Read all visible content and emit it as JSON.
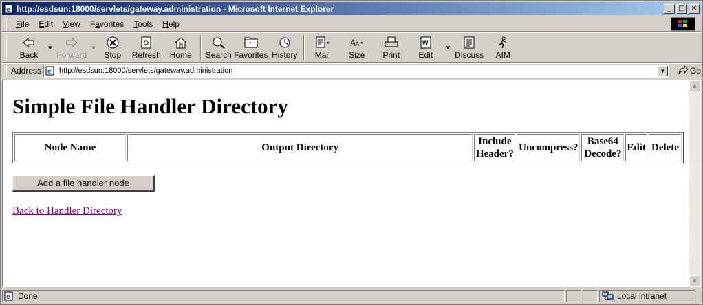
{
  "window": {
    "title": "http://esdsun:18000/servlets/gateway.administration - Microsoft Internet Explorer",
    "controls": {
      "minimize": "_",
      "maximize": "□",
      "close": "✕"
    }
  },
  "menu": {
    "items": [
      {
        "label": "File",
        "key": "F"
      },
      {
        "label": "Edit",
        "key": "E"
      },
      {
        "label": "View",
        "key": "V"
      },
      {
        "label": "Favorites",
        "key": "a"
      },
      {
        "label": "Tools",
        "key": "T"
      },
      {
        "label": "Help",
        "key": "H"
      }
    ]
  },
  "toolbar": {
    "back": "Back",
    "forward": "Forward",
    "stop": "Stop",
    "refresh": "Refresh",
    "home": "Home",
    "search": "Search",
    "favorites": "Favorites",
    "history": "History",
    "mail": "Mail",
    "size": "Size",
    "print": "Print",
    "edit": "Edit",
    "discuss": "Discuss",
    "aim": "AIM"
  },
  "address": {
    "label": "Address",
    "url": "http://esdsun:18000/servlets/gateway.administration",
    "go": "Go"
  },
  "page": {
    "heading": "Simple File Handler Directory",
    "table": {
      "columns": [
        "Node Name",
        "Output Directory",
        "Include Header?",
        "Uncompress?",
        "Base64 Decode?",
        "Edit",
        "Delete"
      ]
    },
    "add_button": "Add a file handler node",
    "back_link": "Back to Handler Directory"
  },
  "status": {
    "text": "Done",
    "zone": "Local intranet"
  },
  "colors": {
    "title_start": "#0a246a",
    "title_end": "#a6caf0",
    "visited_link": "#800080",
    "chrome": "#d4d0c8"
  }
}
